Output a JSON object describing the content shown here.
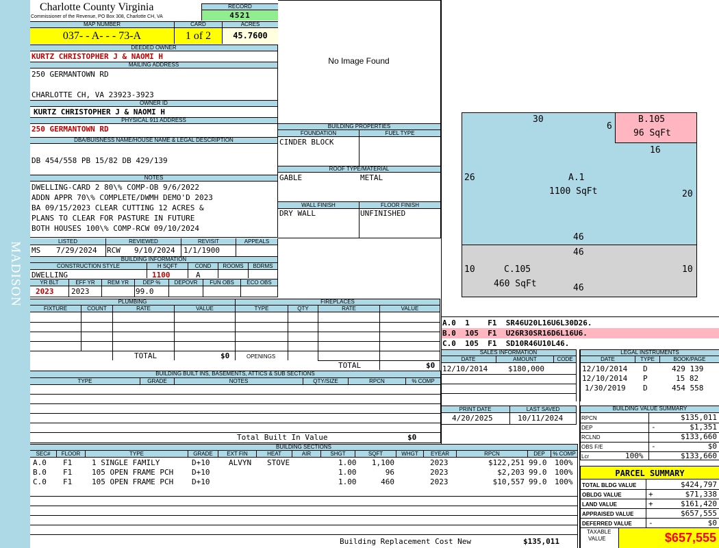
{
  "sidebar": {
    "district": "MADISON"
  },
  "header": {
    "county": "Charlotte County Virginia",
    "commissioner": "Commissioner of the Revenue, PO Box 308, Charlotte CH, VA",
    "record_label": "RECORD",
    "record": "4521",
    "map_number_label": "MAP NUMBER",
    "map_number": "037- - A- - - 73-A",
    "card_label": "CARD",
    "card": "1 of 2",
    "acres_label": "ACRES",
    "acres": "45.7600"
  },
  "owner": {
    "deeded_label": "DEEDED OWNER",
    "deeded_owner": "KURTZ CHRISTOPHER J & NAOMI H",
    "mailing_label": "MAILING ADDRESS",
    "mailing_line1": "250 GERMANTOWN RD",
    "mailing_line2": "CHARLOTTE CH, VA 23923-3923",
    "owner_id_label": "OWNER ID",
    "owner_id": "KURTZ CHRISTOPHER J & NAOMI H",
    "physical_label": "PHYSICAL 911 ADDRESS",
    "physical": "250 GERMANTOWN RD",
    "dba_label": "DBA/BUISNESS NAME/HOUSE NAME & LEGAL DESCRIPTION",
    "legal": "DB 454/558 PB 15/82 DB 429/139"
  },
  "notes": {
    "label": "NOTES",
    "lines": [
      "DWELLING-CARD 2 80\\% COMP-OB 9/6/2022",
      "ADDN APPR 70\\% COMPLETE/DWMH DEMO'D 2023",
      "BA 09/15/2023  CLEAR CUTTING 12 ACRES &",
      "PLANS TO CLEAR FOR PASTURE IN FUTURE",
      "BOTH HOUSES 100\\% COMP-RCW 09/10/2024"
    ]
  },
  "review": {
    "listed_label": "LISTED",
    "reviewed_label": "REVIEWED",
    "revisit_label": "REVISIT",
    "appeals_label": "APPEALS",
    "listed_by": "MS",
    "listed_date": "7/29/2024",
    "reviewed_by": "RCW",
    "reviewed_date": "9/10/2024",
    "revisit": "1/1/1900"
  },
  "building_info": {
    "label": "BUILDING INFORMATION",
    "construction_label": "CONSTRUCTION STYLE",
    "hsqft_label": "H SQFT",
    "cond_label": "COND",
    "rooms_label": "ROOMS",
    "bdrms_label": "BDRMS",
    "construction": "DWELLING",
    "hsqft": "1100",
    "cond": "A",
    "yrblt_label": "YR BLT",
    "effyr_label": "EFF YR",
    "remyr_label": "REM YR",
    "dep_label": "DEP %",
    "depovr_label": "DEPOVR",
    "funobs_label": "FUN OBS",
    "ecoobs_label": "ECO OBS",
    "yrblt": "2023",
    "effyr": "2023",
    "dep": "99.0"
  },
  "plumbing": {
    "label": "PLUMBING",
    "fixture_label": "FIXTURE",
    "count_label": "COUNT",
    "rate_label": "RATE",
    "value_label": "VALUE",
    "total_label": "TOTAL",
    "total": "$0"
  },
  "fireplaces": {
    "label": "FIREPLACES",
    "type_label": "TYPE",
    "qty_label": "QTY",
    "rate_label": "RATE",
    "value_label": "VALUE",
    "openings_label": "OPENINGS",
    "total_label": "TOTAL",
    "total": "$0"
  },
  "image": {
    "no_image": "No Image Found"
  },
  "building_properties": {
    "label": "BUILDING PROPERTIES",
    "foundation_label": "FOUNDATION",
    "fuel_label": "FUEL TYPE",
    "foundation": "CINDER BLOCK",
    "roof_label": "ROOF TYPE/MATERIAL",
    "roof_type": "GABLE",
    "roof_material": "METAL",
    "wall_label": "WALL FINISH",
    "floor_label": "FLOOR FINISH",
    "wall": "DRY WALL",
    "floor": "UNFINISHED"
  },
  "sketch": {
    "a_label": "A.1",
    "a_area": "1100 SqFt",
    "b_label": "B.105",
    "b_area": "96 SqFt",
    "c_label": "C.105",
    "c_area": "460 SqFt",
    "dims": {
      "a_top": "30",
      "a_left": "26",
      "a_right": "20",
      "a_bottom": "46",
      "b_left": "6",
      "b_bottom": "16",
      "c_top": "46",
      "c_left": "10",
      "c_right": "10",
      "c_bottom": "46"
    },
    "lines": [
      "A.0  1    F1  SR46U20L16U6L30D26.",
      "B.0  105  F1  U26R30SR16D6L16U6.",
      "C.0  105  F1  SD10R46U10L46."
    ],
    "colors": {
      "a": "#add8e6",
      "b": "#ffb6c1",
      "c": "#d3d3d3"
    }
  },
  "sales": {
    "label": "SALES INFORMATION",
    "date_label": "DATE",
    "amount_label": "AMOUNT",
    "code_label": "CODE",
    "rows": [
      {
        "date": "12/10/2014",
        "amount": "$180,000",
        "code": ""
      }
    ]
  },
  "legal_instruments": {
    "label": "LEGAL INSTRUMENTS",
    "date_label": "DATE",
    "type_label": "TYPE",
    "book_label": "BOOK/PAGE",
    "rows": [
      {
        "date": "12/10/2014",
        "type": "D",
        "book": "429 139"
      },
      {
        "date": "12/10/2014",
        "type": "P",
        "book": "15 82"
      },
      {
        "date": "1/30/2019",
        "type": "D",
        "book": "454 558"
      }
    ]
  },
  "print": {
    "print_label": "PRINT DATE",
    "saved_label": "LAST SAVED",
    "print_date": "4/20/2025",
    "last_saved": "10/11/2024"
  },
  "built_ins": {
    "label": "BUILDING BUILT INS, BASEMENTS, ATTICS & SUB SECTIONS",
    "type_label": "TYPE",
    "grade_label": "GRADE",
    "notes_label": "NOTES",
    "qty_label": "QTY/SIZE",
    "rpcn_label": "RPCN",
    "comp_label": "% COMP",
    "total_label": "Total Built In Value",
    "total": "$0"
  },
  "sections": {
    "label": "BUILDING SECTIONS",
    "headers": [
      "SEC#",
      "FLOOR",
      "TYPE",
      "GRADE",
      "EXT FIN",
      "HEAT",
      "AIR",
      "SHGT",
      "SQFT",
      "WHGT",
      "EYEAR",
      "RPCN",
      "DEP",
      "% COMP"
    ],
    "rows": [
      [
        "A.0",
        "F1",
        "1 SINGLE FAMILY",
        "D+10",
        "ALVYN",
        "STOVE",
        "",
        "1.00",
        "1,100",
        "",
        "2023",
        "$122,251",
        "99.0",
        "100%"
      ],
      [
        "B.0",
        "F1",
        "105 OPEN FRAME PCH",
        "D+10",
        "",
        "",
        "",
        "1.00",
        "96",
        "",
        "2023",
        "$2,203",
        "99.0",
        "100%"
      ],
      [
        "C.0",
        "F1",
        "105 OPEN FRAME PCH",
        "D+10",
        "",
        "",
        "",
        "1.00",
        "460",
        "",
        "2023",
        "$10,557",
        "99.0",
        "100%"
      ]
    ],
    "rcn_label": "Building Replacement Cost New",
    "rcn": "$135,011"
  },
  "value_summary": {
    "label": "BUILDING VALUE SUMMARY",
    "rows": [
      {
        "label": "RPCN",
        "extra": "",
        "sign": "",
        "value": "$135,011"
      },
      {
        "label": "DEP",
        "extra": "",
        "sign": "-",
        "value": "$1,351"
      },
      {
        "label": "RCLND",
        "extra": "",
        "sign": "",
        "value": "$133,660"
      },
      {
        "label": "OBS F/E",
        "extra": "",
        "sign": "-",
        "value": "$0"
      },
      {
        "label": "Lcr",
        "extra": "100%",
        "sign": "",
        "value": "$133,660"
      }
    ]
  },
  "parcel": {
    "label": "PARCEL SUMMARY",
    "rows": [
      {
        "label": "TOTAL BLDG VALUE",
        "sign": "",
        "value": "$424,797"
      },
      {
        "label": "OBLDG VALUE",
        "sign": "+",
        "value": "$71,338"
      },
      {
        "label": "LAND VALUE",
        "sign": "+",
        "value": "$161,420"
      },
      {
        "label": "APPRAISED VALUE",
        "sign": "",
        "value": "$657,555"
      },
      {
        "label": "DEFERRED VALUE",
        "sign": "-",
        "value": "$0"
      }
    ],
    "taxable_label1": "TAXABLE",
    "taxable_label2": "VALUE",
    "taxable": "$657,555"
  }
}
